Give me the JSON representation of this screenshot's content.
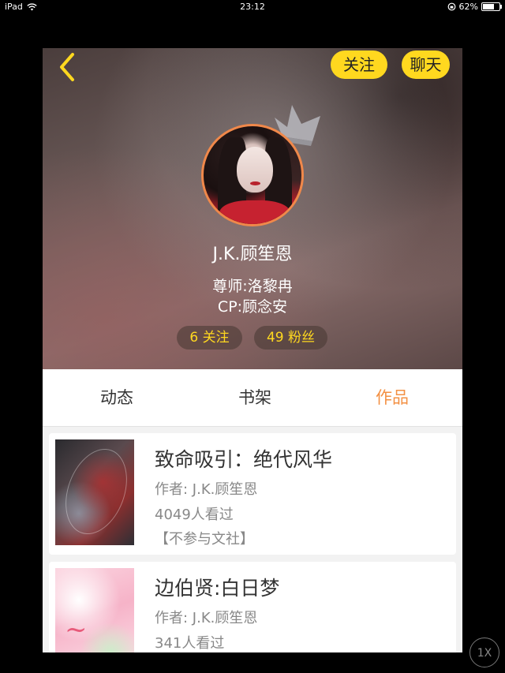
{
  "status_bar": {
    "device": "iPad",
    "time": "23:12",
    "battery": "62%",
    "battery_level": 0.62,
    "icons": [
      "wifi-icon",
      "orientation-lock-icon",
      "battery-icon"
    ]
  },
  "header": {
    "follow_button": "关注",
    "chat_button": "聊天",
    "username": "J.K.顾笙恩",
    "mentor": "尊师:洛黎冉",
    "cp": "CP:顾念安",
    "stats": {
      "following": "6 关注",
      "fans": "49 粉丝"
    },
    "accent_color": "#ffd81f",
    "avatar_ring_color": "#f0884a"
  },
  "tabs": [
    {
      "label": "动态",
      "active": false
    },
    {
      "label": "书架",
      "active": false
    },
    {
      "label": "作品",
      "active": true
    }
  ],
  "active_tab_color": "#f39043",
  "books": [
    {
      "title": "致命吸引：绝代风华",
      "author": "作者: J.K.顾笙恩",
      "views": "4049人看过",
      "tag": "【不参与文社】"
    },
    {
      "title": "边伯贤:白日梦",
      "author": "作者: J.K.顾笙恩",
      "views": "341人看过",
      "tag": ""
    }
  ],
  "zoom_button": "1X"
}
